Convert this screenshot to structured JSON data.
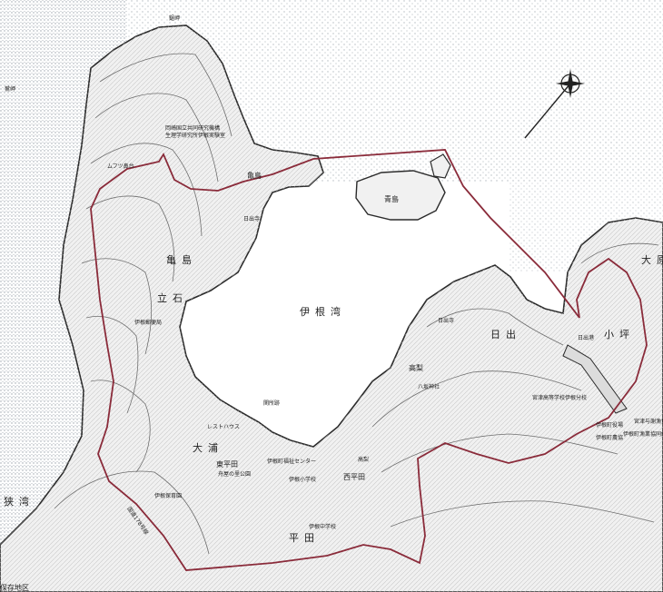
{
  "map": {
    "colors": {
      "sea": "#ffffff",
      "stipple": "#9aa3ab",
      "land": "#efefef",
      "contour": "#6f6f6f",
      "coast": "#2b2b2b",
      "boundary": "#8a2b3a",
      "text": "#222222"
    },
    "compass_icon": "compass-rose-icon",
    "labels": {
      "kanomisaki": "鋸岬",
      "washizaki": "鷲岬",
      "institute_1": "岡崎国立共同研究機構",
      "institute_2": "生理学研究所伊根実験室",
      "mufusu": "ムフツ鼻台",
      "aoshima_peak": "亀島",
      "aoshima_island": "青島",
      "hideyoshi": "日出寺",
      "tateishi": "立石",
      "post_office": "伊根郵便局",
      "ine_bay": "伊根湾",
      "hiji": "日出",
      "hiji_temple": "日出寺",
      "ko": "小坪",
      "ohara": "大原",
      "tachi": "立",
      "kameshima_bay": "亀島",
      "guesthouse": "レストハウス",
      "nyu": "大浦",
      "hirata_east": "東平田",
      "ine_sea_park": "舟屋の里公園",
      "welfare": "伊根町福祉センター",
      "elementary": "伊根小学校",
      "nishihirata": "西平田",
      "middle_school": "伊根中学校",
      "hirata": "平田",
      "nursery": "伊根保育園",
      "highschool": "宮津高等学校伊根分校",
      "town_office": "伊根町役場",
      "agri_coop": "伊根町農協",
      "fishery": "宮津与謝漁協",
      "fish_coop": "伊根町漁業協同組合",
      "hiji_station": "日出港",
      "kaminobaba": "高梨",
      "route_label": "国道178号線",
      "takanashi": "高梨",
      "sekiba": "関所跡",
      "shrine": "八坂神社",
      "west_strait": "狭湾",
      "left_bottom": "保存地区"
    }
  }
}
